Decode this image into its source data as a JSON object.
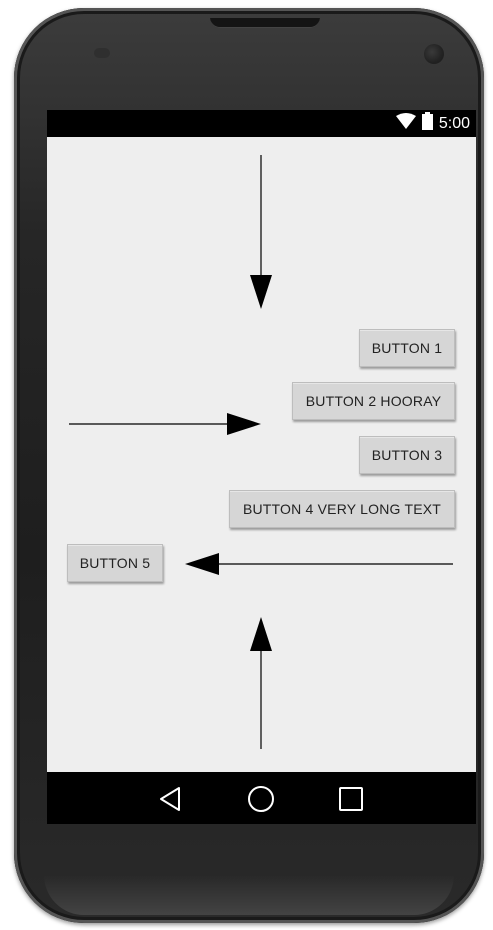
{
  "status_bar": {
    "time": "5:00",
    "icons": [
      "wifi-icon",
      "battery-icon"
    ]
  },
  "buttons": {
    "button1": "BUTTON 1",
    "button2": "BUTTON 2 HOORAY",
    "button3": "BUTTON 3",
    "button4": "BUTTON 4 VERY LONG TEXT",
    "button5": "BUTTON 5"
  },
  "nav_bar": {
    "icons": [
      "back-icon",
      "home-icon",
      "recents-icon"
    ]
  },
  "colors": {
    "screen_background": "#eeeeee",
    "button_background": "#d6d6d6",
    "bars": "#000000"
  }
}
